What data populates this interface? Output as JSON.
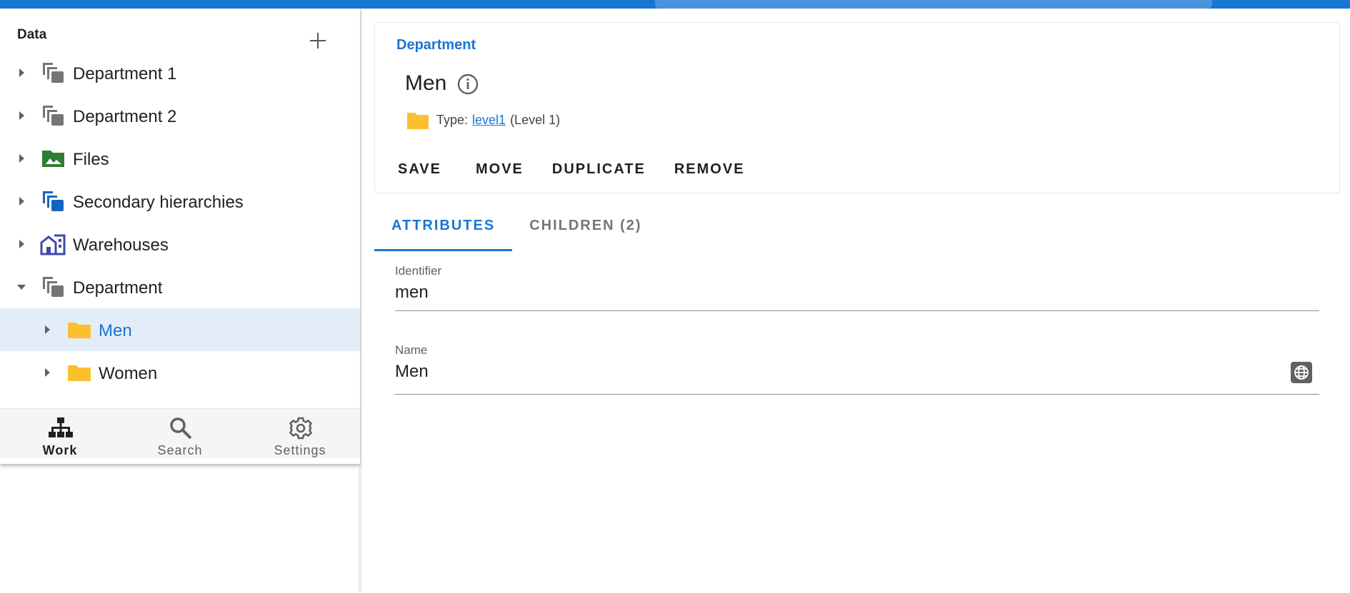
{
  "sidebar": {
    "title": "Data",
    "add_icon": "plus-icon",
    "items": [
      {
        "label": "Department 1",
        "icon": "hierarchy-gray-icon",
        "expanded": false,
        "selected": false,
        "depth": 0
      },
      {
        "label": "Department 2",
        "icon": "hierarchy-gray-icon",
        "expanded": false,
        "selected": false,
        "depth": 0
      },
      {
        "label": "Files",
        "icon": "image-folder-icon",
        "expanded": false,
        "selected": false,
        "depth": 0
      },
      {
        "label": "Secondary hierarchies",
        "icon": "hierarchy-blue-icon",
        "expanded": false,
        "selected": false,
        "depth": 0
      },
      {
        "label": "Warehouses",
        "icon": "building-icon",
        "expanded": false,
        "selected": false,
        "depth": 0
      },
      {
        "label": "Department",
        "icon": "hierarchy-gray-icon",
        "expanded": true,
        "selected": false,
        "depth": 0
      },
      {
        "label": "Men",
        "icon": "folder-icon",
        "expanded": false,
        "selected": true,
        "depth": 1
      },
      {
        "label": "Women",
        "icon": "folder-icon",
        "expanded": false,
        "selected": false,
        "depth": 1
      }
    ]
  },
  "bottom_nav": [
    {
      "label": "Work",
      "icon": "sitemap-icon",
      "active": true
    },
    {
      "label": "Search",
      "icon": "search-icon",
      "active": false
    },
    {
      "label": "Settings",
      "icon": "gear-icon",
      "active": false
    }
  ],
  "header": {
    "breadcrumb": "Department",
    "title": "Men",
    "type_prefix": "Type:",
    "type_link": "level1",
    "type_suffix": "(Level 1)"
  },
  "actions": [
    "SAVE",
    "MOVE",
    "DUPLICATE",
    "REMOVE"
  ],
  "tabs": [
    {
      "label": "ATTRIBUTES",
      "active": true
    },
    {
      "label": "CHILDREN (2)",
      "active": false
    }
  ],
  "fields": {
    "identifier": {
      "label": "Identifier",
      "value": "men"
    },
    "name": {
      "label": "Name",
      "value": "Men"
    }
  },
  "colors": {
    "accent": "#1976d2",
    "folder": "#fbc02d",
    "files_green": "#2e7d32",
    "warehouse": "#3949ab"
  }
}
